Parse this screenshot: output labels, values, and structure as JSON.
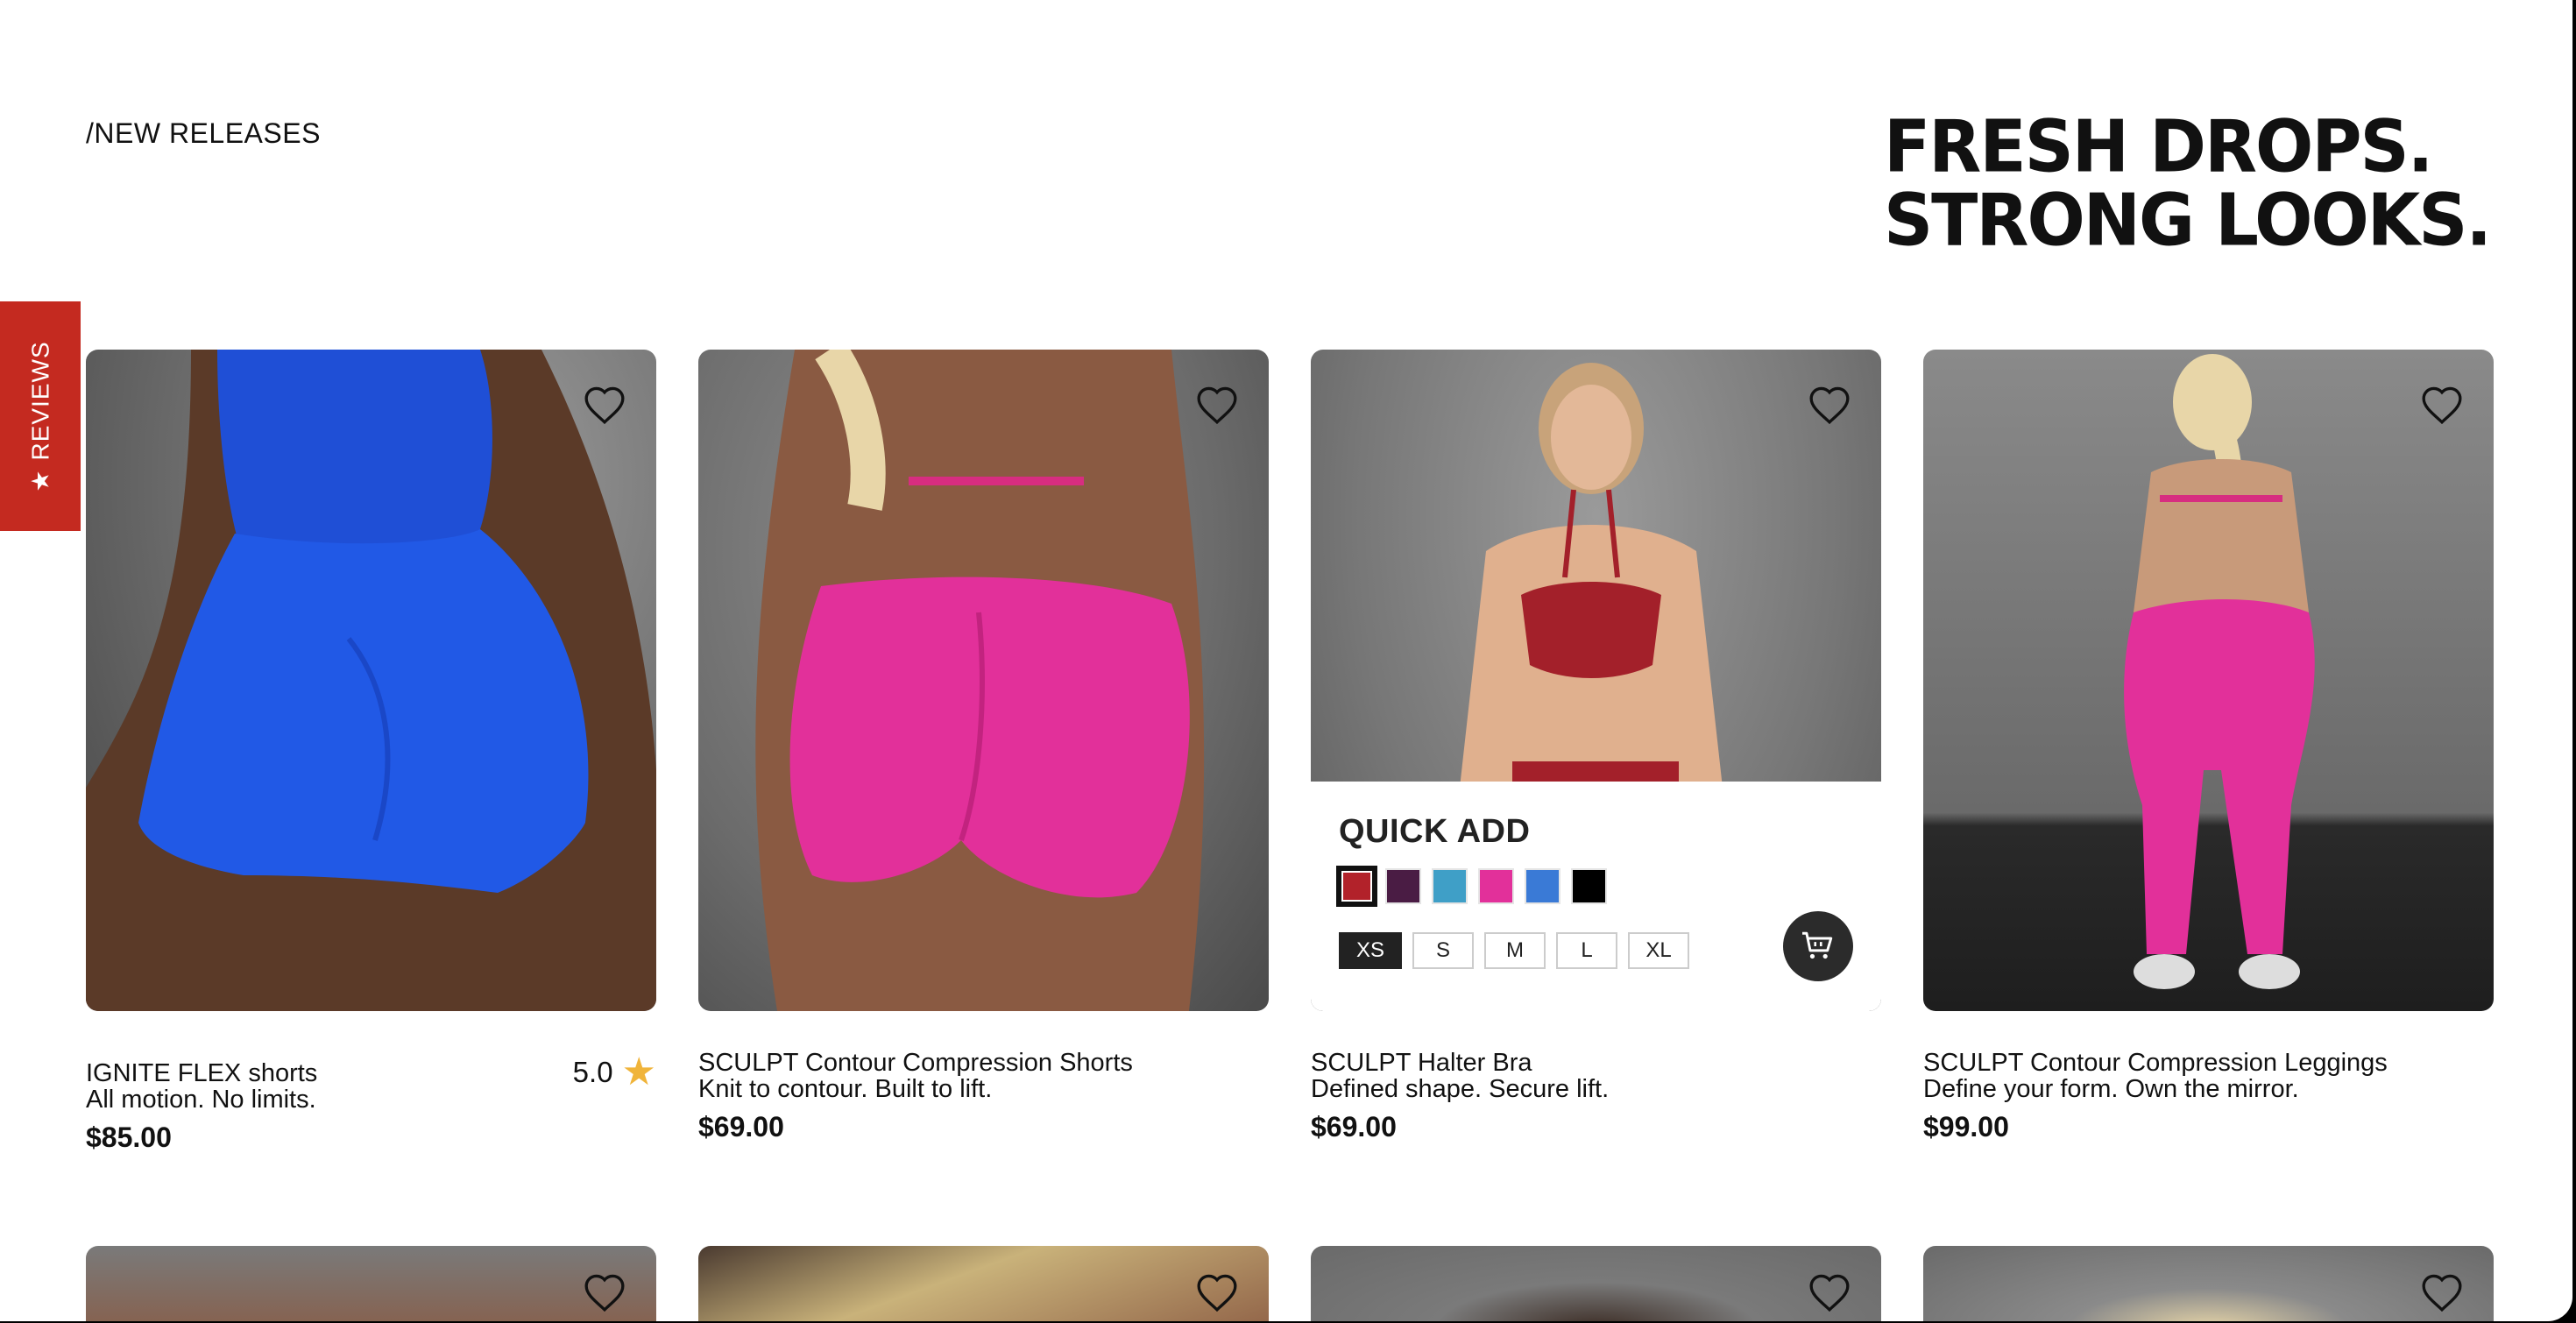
{
  "section_label": "/NEW RELEASES",
  "headline": {
    "line1": "FRESH DROPS.",
    "line2": "STRONG LOOKS."
  },
  "reviews_tab": {
    "label": "REVIEWS",
    "icon": "star-icon"
  },
  "products": [
    {
      "name": "IGNITE FLEX shorts",
      "tagline": "All motion. No limits.",
      "price": "$85.00",
      "rating": "5.0",
      "image_color": "#1f4fd6"
    },
    {
      "name": "SCULPT Contour Compression Shorts",
      "tagline": "Knit to contour. Built to lift.",
      "price": "$69.00",
      "image_color": "#e8309a"
    },
    {
      "name": "SCULPT Halter Bra",
      "tagline": "Defined shape. Secure lift.",
      "price": "$69.00",
      "image_color": "#a3202a"
    },
    {
      "name": "SCULPT Contour Compression Leggings",
      "tagline": "Define your form. Own the mirror.",
      "price": "$99.00",
      "image_color": "#e8309a"
    }
  ],
  "quick_add": {
    "title": "QUICK ADD",
    "swatches": [
      "#b2222a",
      "#4a1c44",
      "#3f9fc7",
      "#e2309a",
      "#3a7ad6",
      "#000000"
    ],
    "selected_swatch": 0,
    "sizes": [
      "XS",
      "S",
      "M",
      "L",
      "XL"
    ],
    "selected_size": "XS",
    "cart_icon": "cart-icon"
  },
  "icons": {
    "favorite": "heart-icon"
  },
  "colors": {
    "reviews_tab": "#c42a20",
    "rating_star": "#f0b43a"
  }
}
